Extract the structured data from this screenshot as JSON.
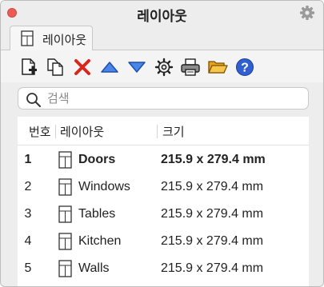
{
  "window": {
    "title": "레이아웃"
  },
  "tab": {
    "label": "레이아웃"
  },
  "toolbar": {
    "buttons": [
      {
        "icon": "new-layout-icon"
      },
      {
        "icon": "duplicate-layout-icon"
      },
      {
        "icon": "delete-icon",
        "color": "#d8261c"
      },
      {
        "icon": "move-up-icon",
        "color": "#3a6fd8"
      },
      {
        "icon": "move-down-icon",
        "color": "#3a6fd8"
      },
      {
        "icon": "properties-gear-icon"
      },
      {
        "icon": "print-icon"
      },
      {
        "icon": "open-folder-icon",
        "color": "#f0b32a"
      },
      {
        "icon": "help-icon",
        "color": "#2f5fd0"
      }
    ]
  },
  "search": {
    "placeholder": "검색",
    "value": ""
  },
  "table": {
    "headers": {
      "number": "번호",
      "layout": "레이아웃",
      "size": "크기"
    },
    "rows": [
      {
        "number": "1",
        "name": "Doors",
        "size": "215.9 x 279.4 mm",
        "active": true
      },
      {
        "number": "2",
        "name": "Windows",
        "size": "215.9 x 279.4 mm",
        "active": false
      },
      {
        "number": "3",
        "name": "Tables",
        "size": "215.9 x 279.4 mm",
        "active": false
      },
      {
        "number": "4",
        "name": "Kitchen",
        "size": "215.9 x 279.4 mm",
        "active": false
      },
      {
        "number": "5",
        "name": "Walls",
        "size": "215.9 x 279.4 mm",
        "active": false
      }
    ]
  }
}
